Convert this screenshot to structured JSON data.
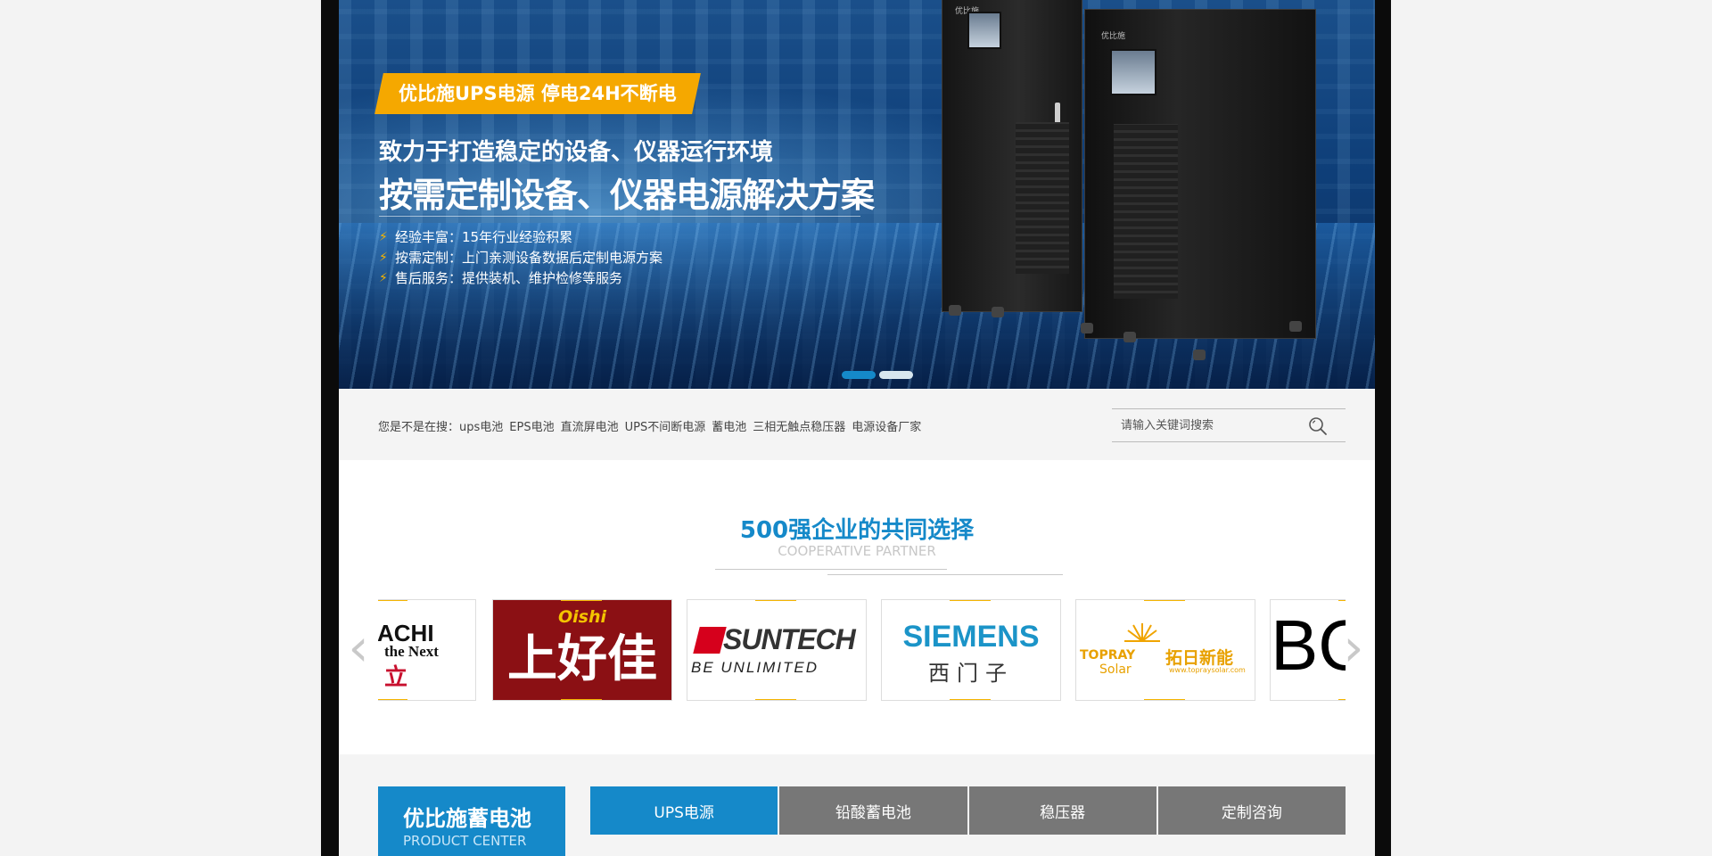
{
  "banner": {
    "tag": "优比施UPS电源 停电24H不断电",
    "headline1": "致力于打造稳定的设备、仪器运行环境",
    "headline2": "按需定制设备、仪器电源解决方案",
    "features": [
      "经验丰富：15年行业经验积累",
      "按需定制：上门亲测设备数据后定制电源方案",
      "售后服务：提供装机、维护检修等服务"
    ],
    "cabinet_brand": "优比施",
    "slides": 2,
    "active_slide": 1,
    "colors": {
      "dot_active": "#1589c9",
      "dot_inactive": "#d7e6ee",
      "tag_bg": "#f5a800"
    }
  },
  "search": {
    "hot_prefix": "您是不是在搜：",
    "hot_keywords": [
      "ups电池",
      "EPS电池",
      "直流屏电池",
      "UPS不间断电源",
      "蓄电池",
      "三相无触点稳压器",
      "电源设备厂家"
    ],
    "placeholder": "请输入关键词搜索",
    "icon": "search-icon"
  },
  "partners": {
    "title": "500强企业的共同选择",
    "subtitle": "COOPERATIVE PARTNER",
    "logos": [
      {
        "name": "hitachi",
        "line1": "ACHI",
        "line2": "the Next",
        "line3": "立"
      },
      {
        "name": "oishi",
        "top": "Oishi",
        "cn": "上好佳"
      },
      {
        "name": "suntech",
        "main": "SUNTECH",
        "tagline": "BE UNLIMITED"
      },
      {
        "name": "siemens",
        "main": "SIEMENS",
        "cn": "西门子"
      },
      {
        "name": "topray",
        "en1": "TOPRAY",
        "en2": "Solar",
        "cn": "拓日新能",
        "url": "www.topraysolar.com"
      },
      {
        "name": "bosch",
        "main": "BO"
      }
    ],
    "prev_icon": "chevron-left-icon",
    "next_icon": "chevron-right-icon"
  },
  "products": {
    "box_title": "优比施蓄电池",
    "box_subtitle": "PRODUCT CENTER",
    "tabs": [
      "UPS电源",
      "铅酸蓄电池",
      "稳压器",
      "定制咨询"
    ],
    "active_tab": 0,
    "colors": {
      "active": "#1589c9",
      "inactive": "#777777"
    }
  }
}
